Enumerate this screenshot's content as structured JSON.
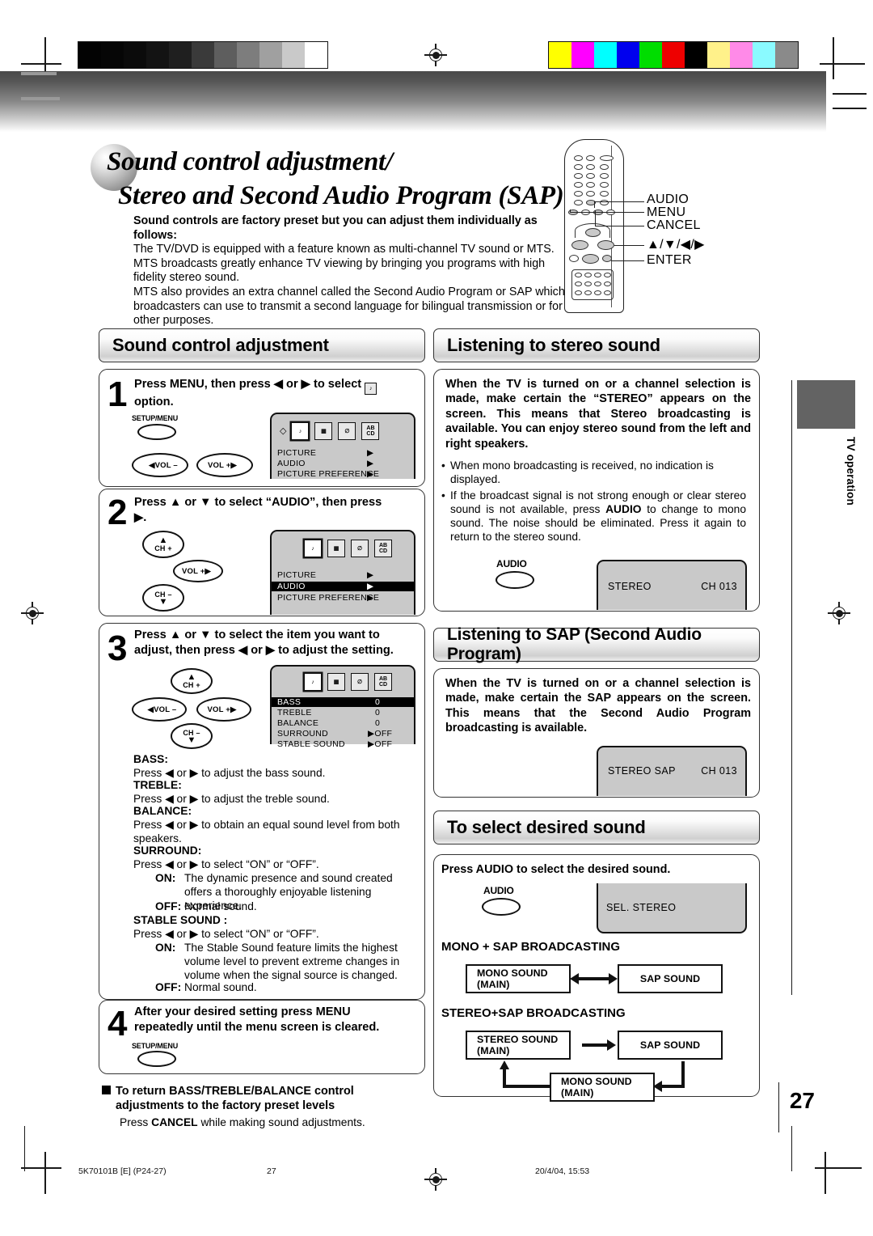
{
  "document": {
    "title_line1": "Sound control adjustment/",
    "title_line2": "Stereo and Second Audio Program (SAP)",
    "page_number": "27",
    "side_tab_label": "TV operation",
    "footer_left": "5K70101B [E] (P24-27)",
    "footer_center": "27",
    "footer_right": "20/4/04, 15:53"
  },
  "intro": {
    "lead": "Sound controls are factory preset but you can adjust them individually as follows:",
    "p1": "The TV/DVD is equipped with a feature known as multi-channel TV sound or MTS. MTS broadcasts greatly enhance TV viewing by bringing you programs with high fidelity stereo sound.",
    "p2": "MTS also provides an extra channel called the Second Audio Program or SAP which broadcasters can use to transmit a second language for bilingual transmission or for other purposes."
  },
  "remote": {
    "labels": [
      "AUDIO",
      "MENU",
      "CANCEL",
      "▲/▼/◀/▶",
      "ENTER"
    ]
  },
  "sections": {
    "sound_control": "Sound control adjustment",
    "stereo": "Listening to stereo sound",
    "sap": "Listening to SAP (Second Audio Program)",
    "desired": "To select desired sound"
  },
  "steps": [
    {
      "num": "1",
      "text": "Press MENU, then press ◀ or ▶ to select ♪ option.",
      "text_a": "Press MENU, then press ◀ or ▶ to select",
      "text_b": "option.",
      "keys": {
        "setup_menu": "SETUP/MENU",
        "vol_minus": "VOL –",
        "vol_plus": "VOL +"
      },
      "osd": {
        "rows": [
          {
            "label": "PICTURE",
            "value": "▶",
            "highlight": false
          },
          {
            "label": "AUDIO",
            "value": "▶",
            "highlight": false
          },
          {
            "label": "PICTURE  PREFERENCE",
            "value": "▶",
            "highlight": false
          }
        ]
      }
    },
    {
      "num": "2",
      "text_a": "Press ▲ or ▼ to select “AUDIO”, then press",
      "text_b": "▶.",
      "keys": {
        "ch_plus": "CH +",
        "ch_minus": "CH –",
        "vol_plus": "VOL +"
      },
      "osd": {
        "rows": [
          {
            "label": "PICTURE",
            "value": "▶",
            "highlight": false
          },
          {
            "label": "AUDIO",
            "value": "▶",
            "highlight": true
          },
          {
            "label": "PICTURE  PREFERENCE",
            "value": "▶",
            "highlight": false
          }
        ]
      }
    },
    {
      "num": "3",
      "text_a": "Press ▲ or ▼ to select the item you want to",
      "text_b": "adjust, then press ◀ or ▶ to adjust the setting.",
      "keys": {
        "ch_plus": "CH +",
        "ch_minus": "CH –",
        "vol_plus": "VOL +",
        "vol_minus": "VOL –"
      },
      "osd": {
        "rows": [
          {
            "label": "BASS",
            "value": "0",
            "highlight": true
          },
          {
            "label": "TREBLE",
            "value": "0",
            "highlight": false
          },
          {
            "label": "BALANCE",
            "value": "0",
            "highlight": false
          },
          {
            "label": "SURROUND",
            "value": "▶OFF",
            "highlight": false
          },
          {
            "label": "STABLE SOUND",
            "value": "▶OFF",
            "highlight": false
          }
        ]
      }
    },
    {
      "num": "4",
      "text_a": "After your desired setting press MENU",
      "text_b": "repeatedly until the menu screen is cleared.",
      "keys": {
        "setup_menu": "SETUP/MENU"
      }
    }
  ],
  "adjust_items": [
    {
      "name": "BASS:",
      "desc": "Press ◀ or ▶ to adjust the bass sound."
    },
    {
      "name": "TREBLE:",
      "desc": "Press ◀ or ▶ to adjust the treble sound."
    },
    {
      "name": "BALANCE:",
      "desc": "Press ◀ or ▶ to obtain an equal sound level from both speakers."
    },
    {
      "name": "SURROUND:",
      "desc": "Press ◀ or ▶ to select “ON” or “OFF”.",
      "on_label": "ON:",
      "on_desc": "The dynamic presence and sound created offers a thoroughly enjoyable listening experience.",
      "off_label": "OFF:",
      "off_desc": "Normal sound."
    },
    {
      "name": "STABLE SOUND :",
      "desc": "Press ◀ or ▶ to select “ON” or “OFF”.",
      "on_label": "ON:",
      "on_desc": "The Stable Sound feature limits the highest volume level to prevent extreme changes in volume when the signal source is changed.",
      "off_label": "OFF:",
      "off_desc": "Normal sound."
    }
  ],
  "reset_note": {
    "heading_l1": "To return BASS/TREBLE/BALANCE control",
    "heading_l2": "adjustments to the factory preset levels",
    "body_a": "Press",
    "body_b": "CANCEL",
    "body_c": "while making sound adjustments."
  },
  "stereo_section": {
    "bold": "When the TV is turned on or a channel selection is made, make certain the “STEREO” appears on the screen. This means that Stereo broadcasting is available. You can enjoy stereo sound from the left and right speakers.",
    "bullet1": "When mono broadcasting is received, no indication is displayed.",
    "bullet2_a": "If the broadcast signal is not strong enough or clear stereo sound is not available, press",
    "bullet2_b": "AUDIO",
    "bullet2_c": "to change to mono sound. The noise should be eliminated. Press it again to return to the stereo sound.",
    "audio_key": "AUDIO",
    "osd_left": "STEREO",
    "osd_right": "CH 013"
  },
  "sap_section": {
    "bold": "When the TV is turned on or a channel selection is made, make certain the SAP appears on the screen. This means that the Second Audio Program broadcasting is available.",
    "osd_left": "STEREO  SAP",
    "osd_right": "CH 013"
  },
  "desired_section": {
    "lead": "Press AUDIO to select the desired sound.",
    "audio_key": "AUDIO",
    "osd_text": "SEL. STEREO",
    "mono_sap_heading": "MONO + SAP BROADCASTING",
    "stereo_sap_heading": "STEREO+SAP BROADCASTING",
    "box_mono_l1": "MONO SOUND",
    "box_mono_l2": "(MAIN)",
    "box_sap": "SAP SOUND",
    "box_stereo_l1": "STEREO SOUND",
    "box_stereo_l2": "(MAIN)",
    "box_sap2": "SAP SOUND",
    "box_mono2_l1": "MONO SOUND",
    "box_mono2_l2": "(MAIN)"
  },
  "print_marks": {
    "grayscale": [
      "#030303",
      "#060606",
      "#0b0b0b",
      "#131313",
      "#1f1f1f",
      "#3a3a3a",
      "#5e5e5e",
      "#7d7d7d",
      "#a0a0a0",
      "#c9c9c9",
      "#ffffff"
    ],
    "colorbars": [
      "#ffff00",
      "#ff00ff",
      "#00ffff",
      "#0000ee",
      "#00dd00",
      "#ee0000",
      "#000000",
      "#fff18a",
      "#ff8ae8",
      "#8afaff",
      "#8a8a8a"
    ]
  }
}
